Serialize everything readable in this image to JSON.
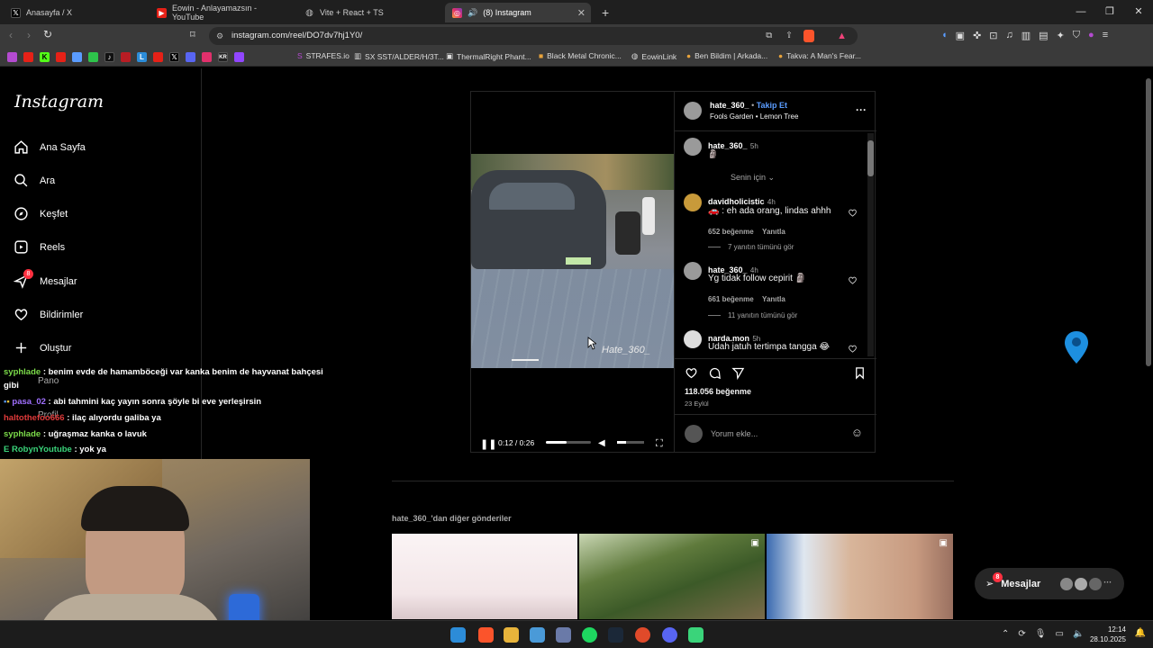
{
  "browser": {
    "tabs": [
      {
        "label": "Anasayfa / X",
        "icon": "x-icon"
      },
      {
        "label": "Eowin - Anlayamazsın - YouTube",
        "icon": "youtube-icon"
      },
      {
        "label": "Vite + React + TS",
        "icon": "globe-icon"
      },
      {
        "label": "(8) Instagram",
        "icon": "instagram-icon",
        "active": true
      }
    ],
    "new_tab": "+",
    "url": "instagram.com/reel/DO7dv7hj1Y0/",
    "bookmarks": [
      {
        "label": "STRAFES.io"
      },
      {
        "label": "SX SST/ALDER/H/3T..."
      },
      {
        "label": "ThermalRight Phant..."
      },
      {
        "label": "Black Metal Chronic..."
      },
      {
        "label": "EowinLink"
      },
      {
        "label": "Ben Bildim | Arkada..."
      },
      {
        "label": "Takva: A Man's Fear..."
      }
    ]
  },
  "instagram": {
    "logo": "Instagram",
    "nav": [
      {
        "label": "Ana Sayfa",
        "icon": "home-icon"
      },
      {
        "label": "Ara",
        "icon": "search-icon"
      },
      {
        "label": "Keşfet",
        "icon": "compass-icon"
      },
      {
        "label": "Reels",
        "icon": "reels-icon"
      },
      {
        "label": "Mesajlar",
        "icon": "messenger-icon",
        "badge": "8"
      },
      {
        "label": "Bildirimler",
        "icon": "heart-icon"
      },
      {
        "label": "Oluştur",
        "icon": "plus-icon"
      }
    ],
    "partial_nav": [
      "Pano",
      "Profil"
    ]
  },
  "post": {
    "author": "hate_360_",
    "follow": "Takip Et",
    "song": "Fools Garden • Lemon Tree",
    "caption_user": "hate_360_",
    "caption_time": "5h",
    "caption_text": "🗿",
    "filter": "Senin için",
    "watermark": "Hate_360_",
    "video_time": "0:12 / 0:26",
    "video_progress": 0.46,
    "comments": [
      {
        "user": "davidholicistic",
        "time": "4h",
        "text": "🚗 : eh ada orang, lindas ahhh",
        "likes": "652 beğenme",
        "reply": "Yanıtla",
        "view_replies": "7 yanıtın tümünü gör"
      },
      {
        "user": "hate_360_",
        "time": "4h",
        "text": "Yg tidak follow cepirit 🗿",
        "likes": "661 beğenme",
        "reply": "Yanıtla",
        "view_replies": "11 yanıtın tümünü gör"
      },
      {
        "user": "narda.mon",
        "time": "5h",
        "text": "Udah jatuh tertimpa tangga 😂"
      }
    ],
    "likes": "118.056 beğenme",
    "date": "23 Eylül",
    "comment_placeholder": "Yorum ekle..."
  },
  "more": {
    "label": "hate_360_'dan diğer gönderiler"
  },
  "chat": [
    {
      "user": "syphlade",
      "user_color": "#7cdc4a",
      "text": ": benim evde de hamamböceği var kanka benim de hayvanat bahçesi"
    },
    {
      "user": "",
      "user_color": "#ffffff",
      "text": "gibi"
    },
    {
      "user": "pasa_02",
      "user_color": "#a070ff",
      "text": ": abi tahmini kaç yayın sonra şöyle bi eve yerleşirsin"
    },
    {
      "user": "haltothefoo666",
      "user_color": "#e03a3a",
      "text": ": ilaç alıyordu galiba ya"
    },
    {
      "user": "syphlade",
      "user_color": "#7cdc4a",
      "text": ": uğraşmaz kanka o lavuk"
    },
    {
      "user": "RobynYoutube",
      "user_color": "#3ad47a",
      "text": ": yok ya"
    }
  ],
  "messages_pill": {
    "label": "Mesajlar",
    "badge": "8"
  },
  "clock": {
    "time": "12:14",
    "date": "28.10.2025"
  }
}
